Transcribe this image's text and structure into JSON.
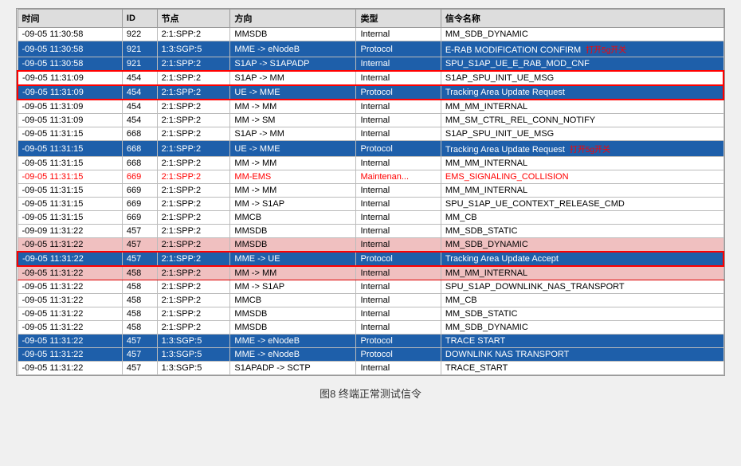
{
  "caption": "图8  终端正常测试信令",
  "columns": [
    "时间",
    "ID",
    "节点",
    "方向",
    "类型",
    "信令名称"
  ],
  "rows": [
    {
      "time": "-09-05 11:30:58",
      "id": "922",
      "node": "2:1:SPP:2",
      "dir": "MMSDB",
      "type": "Internal",
      "name": "MM_SDB_DYNAMIC",
      "style": "normal"
    },
    {
      "time": "-09-05 11:30:58",
      "id": "921",
      "node": "1:3:SGP:5",
      "dir": "MME -> eNodeB",
      "type": "Protocol",
      "name": "E-RAB MODIFICATION CONFIRM",
      "style": "blue",
      "annot": "打开5g开关"
    },
    {
      "time": "-09-05 11:30:58",
      "id": "921",
      "node": "2:1:SPP:2",
      "dir": "S1AP -> S1APADP",
      "type": "Internal",
      "name": "SPU_S1AP_UE_E_RAB_MOD_CNF",
      "style": "blue"
    },
    {
      "time": "-09-05 11:31:09",
      "id": "454",
      "node": "2:1:SPP:2",
      "dir": "S1AP -> MM",
      "type": "Internal",
      "name": "S1AP_SPU_INIT_UE_MSG",
      "style": "red-border"
    },
    {
      "time": "-09-05 11:31:09",
      "id": "454",
      "node": "2:1:SPP:2",
      "dir": "UE -> MME",
      "type": "Protocol",
      "name": "Tracking Area Update Request",
      "style": "blue-red"
    },
    {
      "time": "-09-05 11:31:09",
      "id": "454",
      "node": "2:1:SPP:2",
      "dir": "MM -> MM",
      "type": "Internal",
      "name": "MM_MM_INTERNAL",
      "style": "normal"
    },
    {
      "time": "-09-05 11:31:09",
      "id": "454",
      "node": "2:1:SPP:2",
      "dir": "MM -> SM",
      "type": "Internal",
      "name": "MM_SM_CTRL_REL_CONN_NOTIFY",
      "style": "normal"
    },
    {
      "time": "-09-05 11:31:15",
      "id": "668",
      "node": "2:1:SPP:2",
      "dir": "S1AP -> MM",
      "type": "Internal",
      "name": "S1AP_SPU_INIT_UE_MSG",
      "style": "normal"
    },
    {
      "time": "-09-05 11:31:15",
      "id": "668",
      "node": "2:1:SPP:2",
      "dir": "UE -> MME",
      "type": "Protocol",
      "name": "Tracking Area Update Request",
      "style": "blue",
      "annot": "打开5g开关"
    },
    {
      "time": "-09-05 11:31:15",
      "id": "668",
      "node": "2:1:SPP:2",
      "dir": "MM -> MM",
      "type": "Internal",
      "name": "MM_MM_INTERNAL",
      "style": "normal"
    },
    {
      "time": "-09-05 11:31:15",
      "id": "669",
      "node": "2:1:SPP:2",
      "dir": "MM-EMS",
      "type": "Maintenan...",
      "name": "EMS_SIGNALING_COLLISION",
      "style": "collision"
    },
    {
      "time": "-09-05 11:31:15",
      "id": "669",
      "node": "2:1:SPP:2",
      "dir": "MM -> MM",
      "type": "Internal",
      "name": "MM_MM_INTERNAL",
      "style": "normal"
    },
    {
      "time": "-09-05 11:31:15",
      "id": "669",
      "node": "2:1:SPP:2",
      "dir": "MM -> S1AP",
      "type": "Internal",
      "name": "SPU_S1AP_UE_CONTEXT_RELEASE_CMD",
      "style": "normal"
    },
    {
      "time": "-09-05 11:31:15",
      "id": "669",
      "node": "2:1:SPP:2",
      "dir": "MMCB",
      "type": "Internal",
      "name": "MM_CB",
      "style": "normal"
    },
    {
      "time": "-09-09 11:31:22",
      "id": "457",
      "node": "2:1:SPP:2",
      "dir": "MMSDB",
      "type": "Internal",
      "name": "MM_SDB_STATIC",
      "style": "normal"
    },
    {
      "time": "-09-05 11:31:22",
      "id": "457",
      "node": "2:1:SPP:2",
      "dir": "MMSDB",
      "type": "Internal",
      "name": "MM_SDB_DYNAMIC",
      "style": "pink"
    },
    {
      "time": "-09-05 11:31:22",
      "id": "457",
      "node": "2:1:SPP:2",
      "dir": "MME -> UE",
      "type": "Protocol",
      "name": "Tracking Area Update Accept",
      "style": "blue-red2"
    },
    {
      "time": "-09-05 11:31:22",
      "id": "458",
      "node": "2:1:SPP:2",
      "dir": "MM -> MM",
      "type": "Internal",
      "name": "MM_MM_INTERNAL",
      "style": "pink2"
    },
    {
      "time": "-09-05 11:31:22",
      "id": "458",
      "node": "2:1:SPP:2",
      "dir": "MM -> S1AP",
      "type": "Internal",
      "name": "SPU_S1AP_DOWNLINK_NAS_TRANSPORT",
      "style": "normal"
    },
    {
      "time": "-09-05 11:31:22",
      "id": "458",
      "node": "2:1:SPP:2",
      "dir": "MMCB",
      "type": "Internal",
      "name": "MM_CB",
      "style": "normal"
    },
    {
      "time": "-09-05 11:31:22",
      "id": "458",
      "node": "2:1:SPP:2",
      "dir": "MMSDB",
      "type": "Internal",
      "name": "MM_SDB_STATIC",
      "style": "normal"
    },
    {
      "time": "-09-05 11:31:22",
      "id": "458",
      "node": "2:1:SPP:2",
      "dir": "MMSDB",
      "type": "Internal",
      "name": "MM_SDB_DYNAMIC",
      "style": "normal"
    },
    {
      "time": "-09-05 11:31:22",
      "id": "457",
      "node": "1:3:SGP:5",
      "dir": "MME -> eNodeB",
      "type": "Protocol",
      "name": "TRACE START",
      "style": "blue"
    },
    {
      "time": "-09-05 11:31:22",
      "id": "457",
      "node": "1:3:SGP:5",
      "dir": "MME -> eNodeB",
      "type": "Protocol",
      "name": "DOWNLINK NAS TRANSPORT",
      "style": "blue"
    },
    {
      "time": "-09-05 11:31:22",
      "id": "457",
      "node": "1:3:SGP:5",
      "dir": "S1APADP -> SCTP",
      "type": "Internal",
      "name": "TRACE_START",
      "style": "normal"
    }
  ]
}
